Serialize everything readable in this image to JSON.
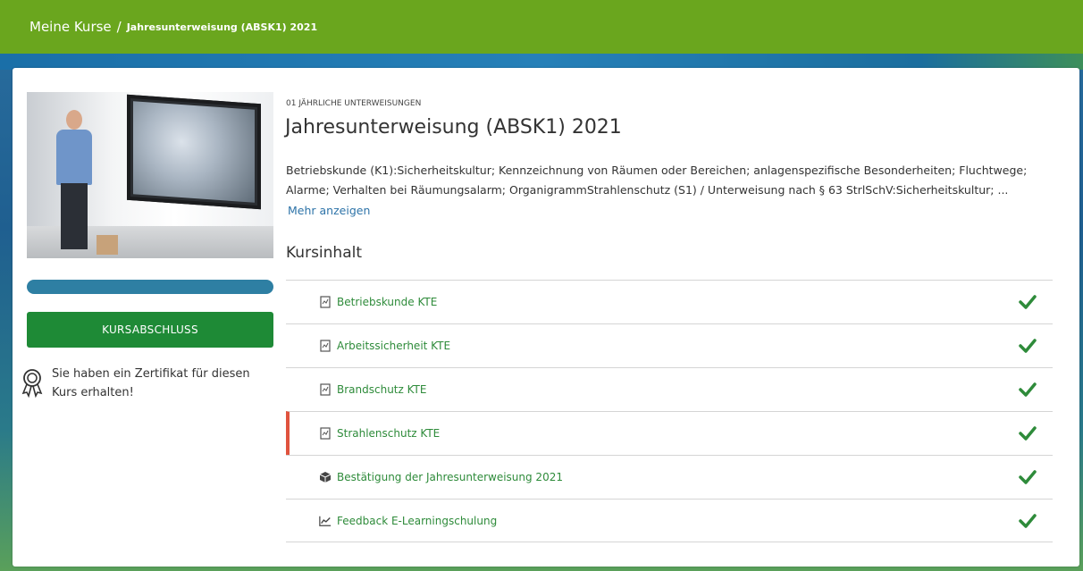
{
  "breadcrumb": {
    "home": "Meine Kurse",
    "separator": "/",
    "current": "Jahresunterweisung (ABSK1) 2021"
  },
  "sidebar": {
    "progress_percent": 100,
    "complete_button_label": "KURSABSCHLUSS",
    "certificate_text": "Sie haben ein Zertifikat für diesen Kurs erhalten!"
  },
  "course": {
    "category": "01 JÄHRLICHE UNTERWEISUNGEN",
    "title": "Jahresunterweisung (ABSK1) 2021",
    "description": "Betriebskunde (K1):Sicherheitskultur; Kennzeichnung von Räumen oder Bereichen; anlagenspezifische Besonderheiten; Fluchtwege; Alarme; Verhalten bei Räumungsalarm; OrganigrammStrahlenschutz (S1) / Unterweisung nach § 63 StrlSchV:Sicherheitskultur; ...",
    "show_more": "Mehr anzeigen",
    "content_heading": "Kursinhalt"
  },
  "lessons": [
    {
      "label": "Betriebskunde KTE",
      "icon": "document-icon",
      "completed": true
    },
    {
      "label": "Arbeitssicherheit KTE",
      "icon": "document-icon",
      "completed": true
    },
    {
      "label": "Brandschutz KTE",
      "icon": "document-icon",
      "completed": true
    },
    {
      "label": "Strahlenschutz KTE",
      "icon": "document-icon",
      "completed": true,
      "active": true
    },
    {
      "label": "Bestätigung der Jahresunterweisung 2021",
      "icon": "cube-icon",
      "completed": true
    },
    {
      "label": "Feedback E-Learningschulung",
      "icon": "chart-icon",
      "completed": true
    }
  ],
  "colors": {
    "topbar": "#6aa61e",
    "button": "#1e8a36",
    "progress": "#2e7fa3",
    "lesson_text": "#2e8b3a",
    "active_marker": "#e0533e",
    "link": "#2d73a8"
  }
}
